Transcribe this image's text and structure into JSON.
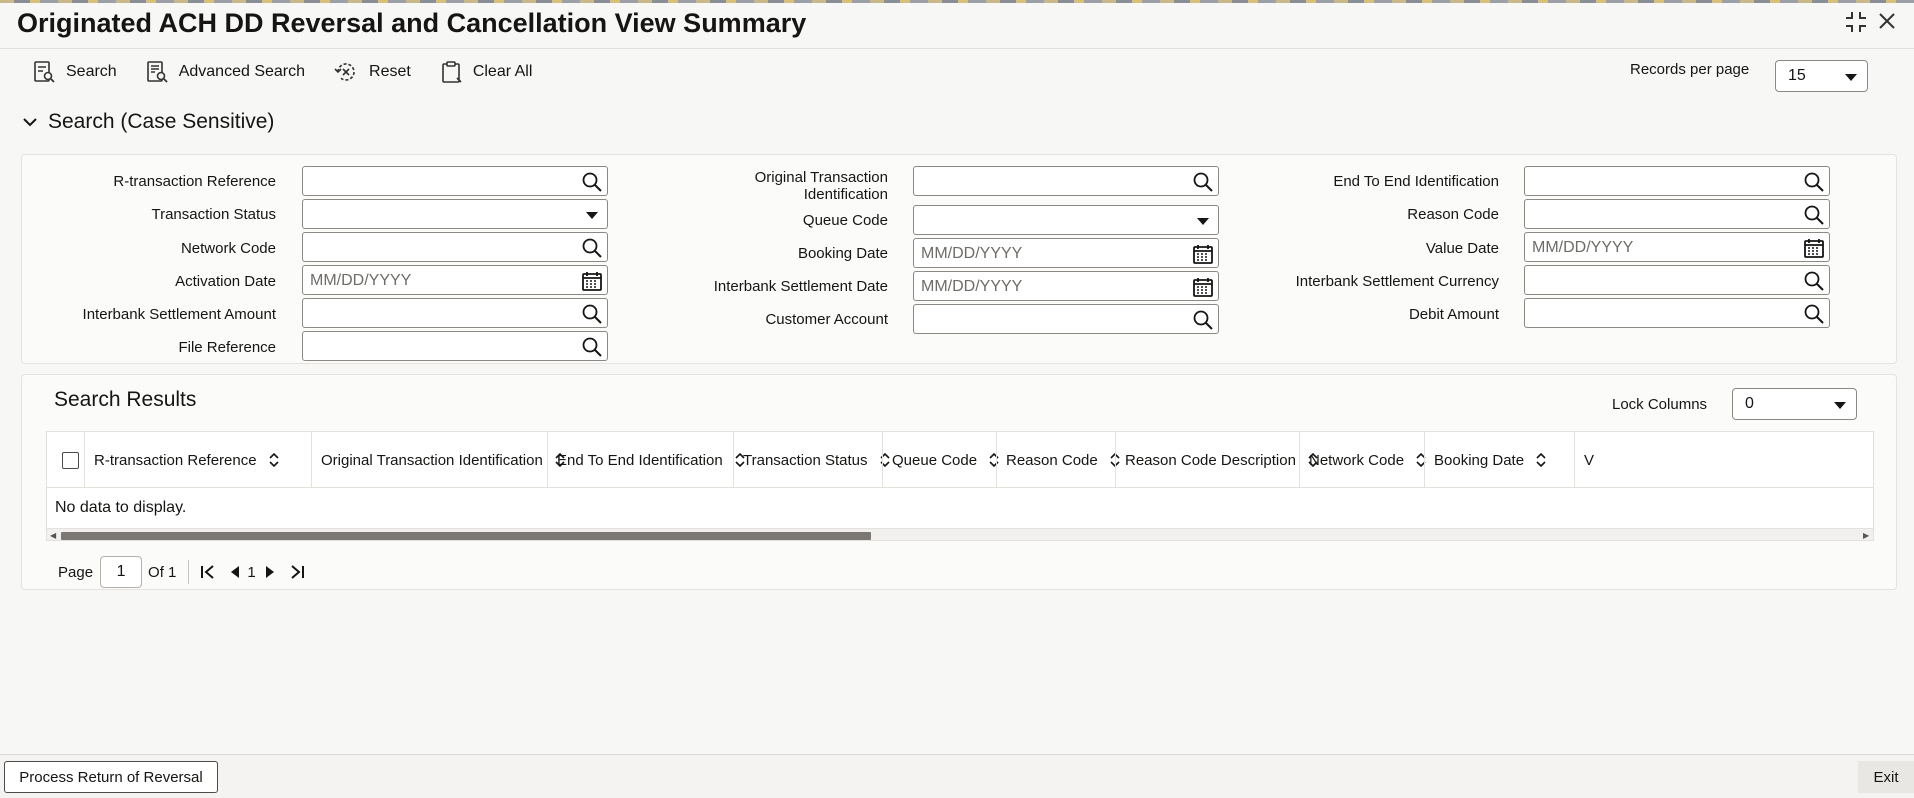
{
  "window": {
    "title": "Originated ACH DD Reversal and Cancellation View Summary",
    "maximize_icon": "collapse-icon",
    "close_icon": "close-icon"
  },
  "toolbar": {
    "search_label": "Search",
    "advanced_search_label": "Advanced Search",
    "reset_label": "Reset",
    "clear_all_label": "Clear All"
  },
  "records_per_page": {
    "label": "Records per page",
    "value": "15"
  },
  "search_section": {
    "title": "Search (Case Sensitive)",
    "fields": {
      "r_transaction_reference": {
        "label": "R-transaction Reference",
        "value": ""
      },
      "transaction_status": {
        "label": "Transaction Status",
        "value": ""
      },
      "network_code": {
        "label": "Network Code",
        "value": ""
      },
      "activation_date": {
        "label": "Activation Date",
        "placeholder": "MM/DD/YYYY"
      },
      "interbank_settlement_amount": {
        "label": "Interbank Settlement Amount",
        "value": ""
      },
      "file_reference": {
        "label": "File Reference",
        "value": ""
      },
      "original_transaction_identification": {
        "label_line1": "Original Transaction",
        "label_line2": "Identification",
        "value": ""
      },
      "queue_code": {
        "label": "Queue Code",
        "value": ""
      },
      "booking_date": {
        "label": "Booking Date",
        "placeholder": "MM/DD/YYYY"
      },
      "interbank_settlement_date": {
        "label": "Interbank Settlement Date",
        "placeholder": "MM/DD/YYYY"
      },
      "customer_account": {
        "label": "Customer Account",
        "value": ""
      },
      "end_to_end_identification": {
        "label": "End To End Identification",
        "value": ""
      },
      "reason_code": {
        "label": "Reason Code",
        "value": ""
      },
      "value_date": {
        "label": "Value Date",
        "placeholder": "MM/DD/YYYY"
      },
      "interbank_settlement_currency": {
        "label": "Interbank Settlement Currency",
        "value": ""
      },
      "debit_amount": {
        "label": "Debit Amount",
        "value": ""
      }
    }
  },
  "search_results": {
    "title": "Search Results",
    "lock_columns": {
      "label": "Lock Columns",
      "value": "0"
    },
    "columns": [
      "R-transaction Reference",
      "Original Transaction Identification",
      "End To End Identification",
      "Transaction Status",
      "Queue Code",
      "Reason Code",
      "Reason Code Description",
      "Network Code",
      "Booking Date",
      "V"
    ],
    "empty_message": "No data to display."
  },
  "pagination": {
    "page_label": "Page",
    "current_page": "1",
    "of_label": "Of 1",
    "page_number": "1"
  },
  "footer": {
    "process_button": "Process Return of Reversal",
    "exit_button": "Exit"
  }
}
